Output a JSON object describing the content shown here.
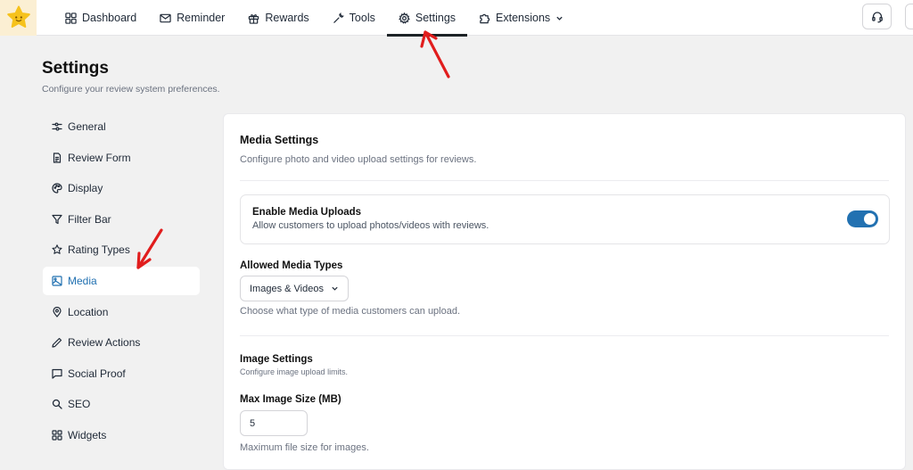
{
  "nav": {
    "items": [
      {
        "label": "Dashboard",
        "icon": "dashboard-icon"
      },
      {
        "label": "Reminder",
        "icon": "mail-icon"
      },
      {
        "label": "Rewards",
        "icon": "gift-icon"
      },
      {
        "label": "Tools",
        "icon": "wrench-icon"
      },
      {
        "label": "Settings",
        "icon": "gear-icon",
        "active": true
      },
      {
        "label": "Extensions",
        "icon": "puzzle-icon"
      }
    ]
  },
  "page": {
    "title": "Settings",
    "subtitle": "Configure your review system preferences."
  },
  "sidebar": {
    "items": [
      {
        "label": "General",
        "icon": "sliders-icon"
      },
      {
        "label": "Review Form",
        "icon": "document-icon"
      },
      {
        "label": "Display",
        "icon": "palette-icon"
      },
      {
        "label": "Filter Bar",
        "icon": "filter-icon"
      },
      {
        "label": "Rating Types",
        "icon": "star-icon"
      },
      {
        "label": "Media",
        "icon": "image-icon",
        "active": true
      },
      {
        "label": "Location",
        "icon": "map-pin-icon"
      },
      {
        "label": "Review Actions",
        "icon": "pencil-icon"
      },
      {
        "label": "Social Proof",
        "icon": "message-icon"
      },
      {
        "label": "SEO",
        "icon": "search-icon"
      },
      {
        "label": "Widgets",
        "icon": "grid-icon"
      }
    ]
  },
  "media": {
    "title": "Media Settings",
    "subtitle": "Configure photo and video upload settings for reviews.",
    "enable_uploads": {
      "title": "Enable Media Uploads",
      "description": "Allow customers to upload photos/videos with reviews.",
      "enabled": true
    },
    "allowed_types": {
      "label": "Allowed Media Types",
      "value": "Images & Videos",
      "help": "Choose what type of media customers can upload."
    },
    "image_settings": {
      "title": "Image Settings",
      "subtitle": "Configure image upload limits.",
      "max_size_label": "Max Image Size (MB)",
      "max_size_value": "5",
      "max_size_help": "Maximum file size for images."
    }
  },
  "colors": {
    "accent": "#2271b1",
    "annotation_arrow": "#e11d1d",
    "logo_bg": "#fbefd3"
  }
}
